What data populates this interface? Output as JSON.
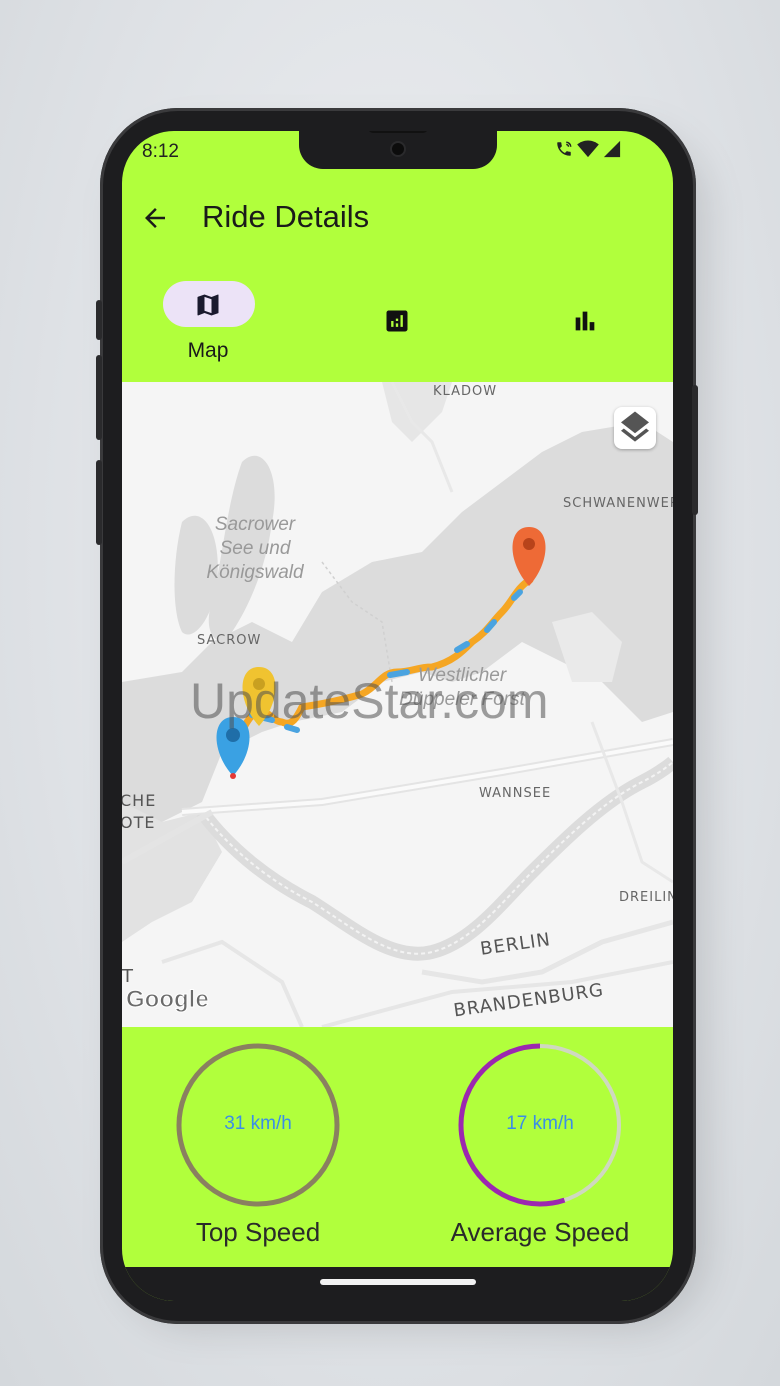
{
  "status_bar": {
    "time": "8:12",
    "icons": [
      "wifi-call-icon",
      "wifi-icon",
      "signal-icon"
    ]
  },
  "app_bar": {
    "title": "Ride Details",
    "back_icon": "arrow-back-icon"
  },
  "tabs": [
    {
      "label": "Map",
      "icon": "map-icon",
      "active": true
    },
    {
      "label": "",
      "icon": "analytics-icon",
      "active": false
    },
    {
      "label": "",
      "icon": "bar-chart-icon",
      "active": false
    }
  ],
  "map": {
    "labels": {
      "kladow": "KLADOW",
      "schwanenwerder": "SCHWANENWER",
      "sacrower_see": "Sacrower\nSee und\nKönigswald",
      "sacrow": "SACROW",
      "westlicher": "Westlicher\nDüppeler Forst",
      "wannsee": "WANNSEE",
      "berliner_vorstadt": "CHE\nOTE",
      "dreilinden": "DREILIN",
      "berlin": "BERLIN",
      "brandenburg": "BRANDENBURG",
      "t_fragment": "T"
    },
    "layers_icon": "layers-icon",
    "attribution": "Google",
    "watermark": "UpdateStar.com",
    "markers": [
      "start-marker-blue",
      "waypoint-marker-yellow",
      "end-marker-orange"
    ]
  },
  "stats": {
    "top_speed": {
      "value": "31 km/h",
      "label": "Top Speed",
      "ring_color": "#8a8060"
    },
    "average_speed": {
      "value": "17 km/h",
      "label": "Average Speed",
      "ring_color": "#9c27b0",
      "progress": 0.55
    }
  },
  "colors": {
    "background": "#b1ff3c",
    "route": "#f5a623",
    "route_alt": "#4aa3e0"
  }
}
